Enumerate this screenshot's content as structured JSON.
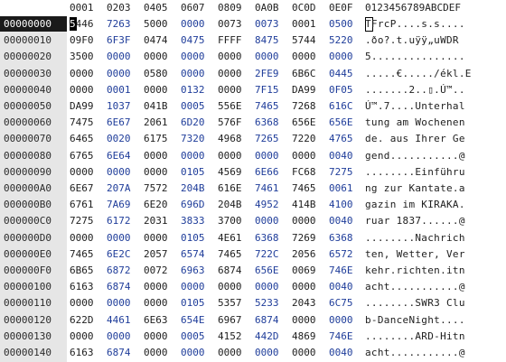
{
  "header": {
    "columns": [
      "0001",
      "0203",
      "0405",
      "0607",
      "0809",
      "0A0B",
      "0C0D",
      "0E0F"
    ],
    "ascii_header": "0123456789ABCDEF"
  },
  "rows": [
    {
      "offset": "00000000",
      "hex": [
        "5446",
        "7263",
        "5000",
        "0000",
        "0073",
        "0073",
        "0001",
        "0500"
      ],
      "ascii": "TFrcP....s.s...."
    },
    {
      "offset": "00000010",
      "hex": [
        "09F0",
        "6F3F",
        "0474",
        "0475",
        "FFFF",
        "8475",
        "5744",
        "5220"
      ],
      "ascii": ".ðo?.t.uÿÿ„uWDR "
    },
    {
      "offset": "00000020",
      "hex": [
        "3500",
        "0000",
        "0000",
        "0000",
        "0000",
        "0000",
        "0000",
        "0000"
      ],
      "ascii": "5..............."
    },
    {
      "offset": "00000030",
      "hex": [
        "0000",
        "0000",
        "0580",
        "0000",
        "0000",
        "2FE9",
        "6B6C",
        "0445"
      ],
      "ascii": ".....€...../ékl.E"
    },
    {
      "offset": "00000040",
      "hex": [
        "0000",
        "0001",
        "0000",
        "0132",
        "0000",
        "7F15",
        "DA99",
        "0F05"
      ],
      "ascii": ".......2..▯.Ú™.."
    },
    {
      "offset": "00000050",
      "hex": [
        "DA99",
        "1037",
        "041B",
        "0005",
        "556E",
        "7465",
        "7268",
        "616C"
      ],
      "ascii": "Ú™.7....Unterhal"
    },
    {
      "offset": "00000060",
      "hex": [
        "7475",
        "6E67",
        "2061",
        "6D20",
        "576F",
        "6368",
        "656E",
        "656E"
      ],
      "ascii": "tung am Wochenen"
    },
    {
      "offset": "00000070",
      "hex": [
        "6465",
        "0020",
        "6175",
        "7320",
        "4968",
        "7265",
        "7220",
        "4765"
      ],
      "ascii": "de. aus Ihrer Ge"
    },
    {
      "offset": "00000080",
      "hex": [
        "6765",
        "6E64",
        "0000",
        "0000",
        "0000",
        "0000",
        "0000",
        "0040"
      ],
      "ascii": "gend...........@"
    },
    {
      "offset": "00000090",
      "hex": [
        "0000",
        "0000",
        "0000",
        "0105",
        "4569",
        "6E66",
        "FC68",
        "7275"
      ],
      "ascii": "........Einführu"
    },
    {
      "offset": "000000A0",
      "hex": [
        "6E67",
        "207A",
        "7572",
        "204B",
        "616E",
        "7461",
        "7465",
        "0061"
      ],
      "ascii": "ng zur Kantate.a"
    },
    {
      "offset": "000000B0",
      "hex": [
        "6761",
        "7A69",
        "6E20",
        "696D",
        "204B",
        "4952",
        "414B",
        "4100"
      ],
      "ascii": "gazin im KIRAKA."
    },
    {
      "offset": "000000C0",
      "hex": [
        "7275",
        "6172",
        "2031",
        "3833",
        "3700",
        "0000",
        "0000",
        "0040"
      ],
      "ascii": "ruar 1837......@"
    },
    {
      "offset": "000000D0",
      "hex": [
        "0000",
        "0000",
        "0000",
        "0105",
        "4E61",
        "6368",
        "7269",
        "6368"
      ],
      "ascii": "........Nachrich"
    },
    {
      "offset": "000000E0",
      "hex": [
        "7465",
        "6E2C",
        "2057",
        "6574",
        "7465",
        "722C",
        "2056",
        "6572"
      ],
      "ascii": "ten, Wetter, Ver"
    },
    {
      "offset": "000000F0",
      "hex": [
        "6B65",
        "6872",
        "0072",
        "6963",
        "6874",
        "656E",
        "0069",
        "746E"
      ],
      "ascii": "kehr.richten.itn"
    },
    {
      "offset": "00000100",
      "hex": [
        "6163",
        "6874",
        "0000",
        "0000",
        "0000",
        "0000",
        "0000",
        "0040"
      ],
      "ascii": "acht...........@"
    },
    {
      "offset": "00000110",
      "hex": [
        "0000",
        "0000",
        "0000",
        "0105",
        "5357",
        "5233",
        "2043",
        "6C75"
      ],
      "ascii": "........SWR3 Clu"
    },
    {
      "offset": "00000120",
      "hex": [
        "622D",
        "4461",
        "6E63",
        "654E",
        "6967",
        "6874",
        "0000",
        "0000"
      ],
      "ascii": "b-DanceNight...."
    },
    {
      "offset": "00000130",
      "hex": [
        "0000",
        "0000",
        "0000",
        "0005",
        "4152",
        "442D",
        "4869",
        "746E"
      ],
      "ascii": "........ARD-Hitn"
    },
    {
      "offset": "00000140",
      "hex": [
        "6163",
        "6874",
        "0000",
        "0000",
        "0000",
        "0000",
        "0000",
        "0040"
      ],
      "ascii": "acht...........@"
    }
  ]
}
